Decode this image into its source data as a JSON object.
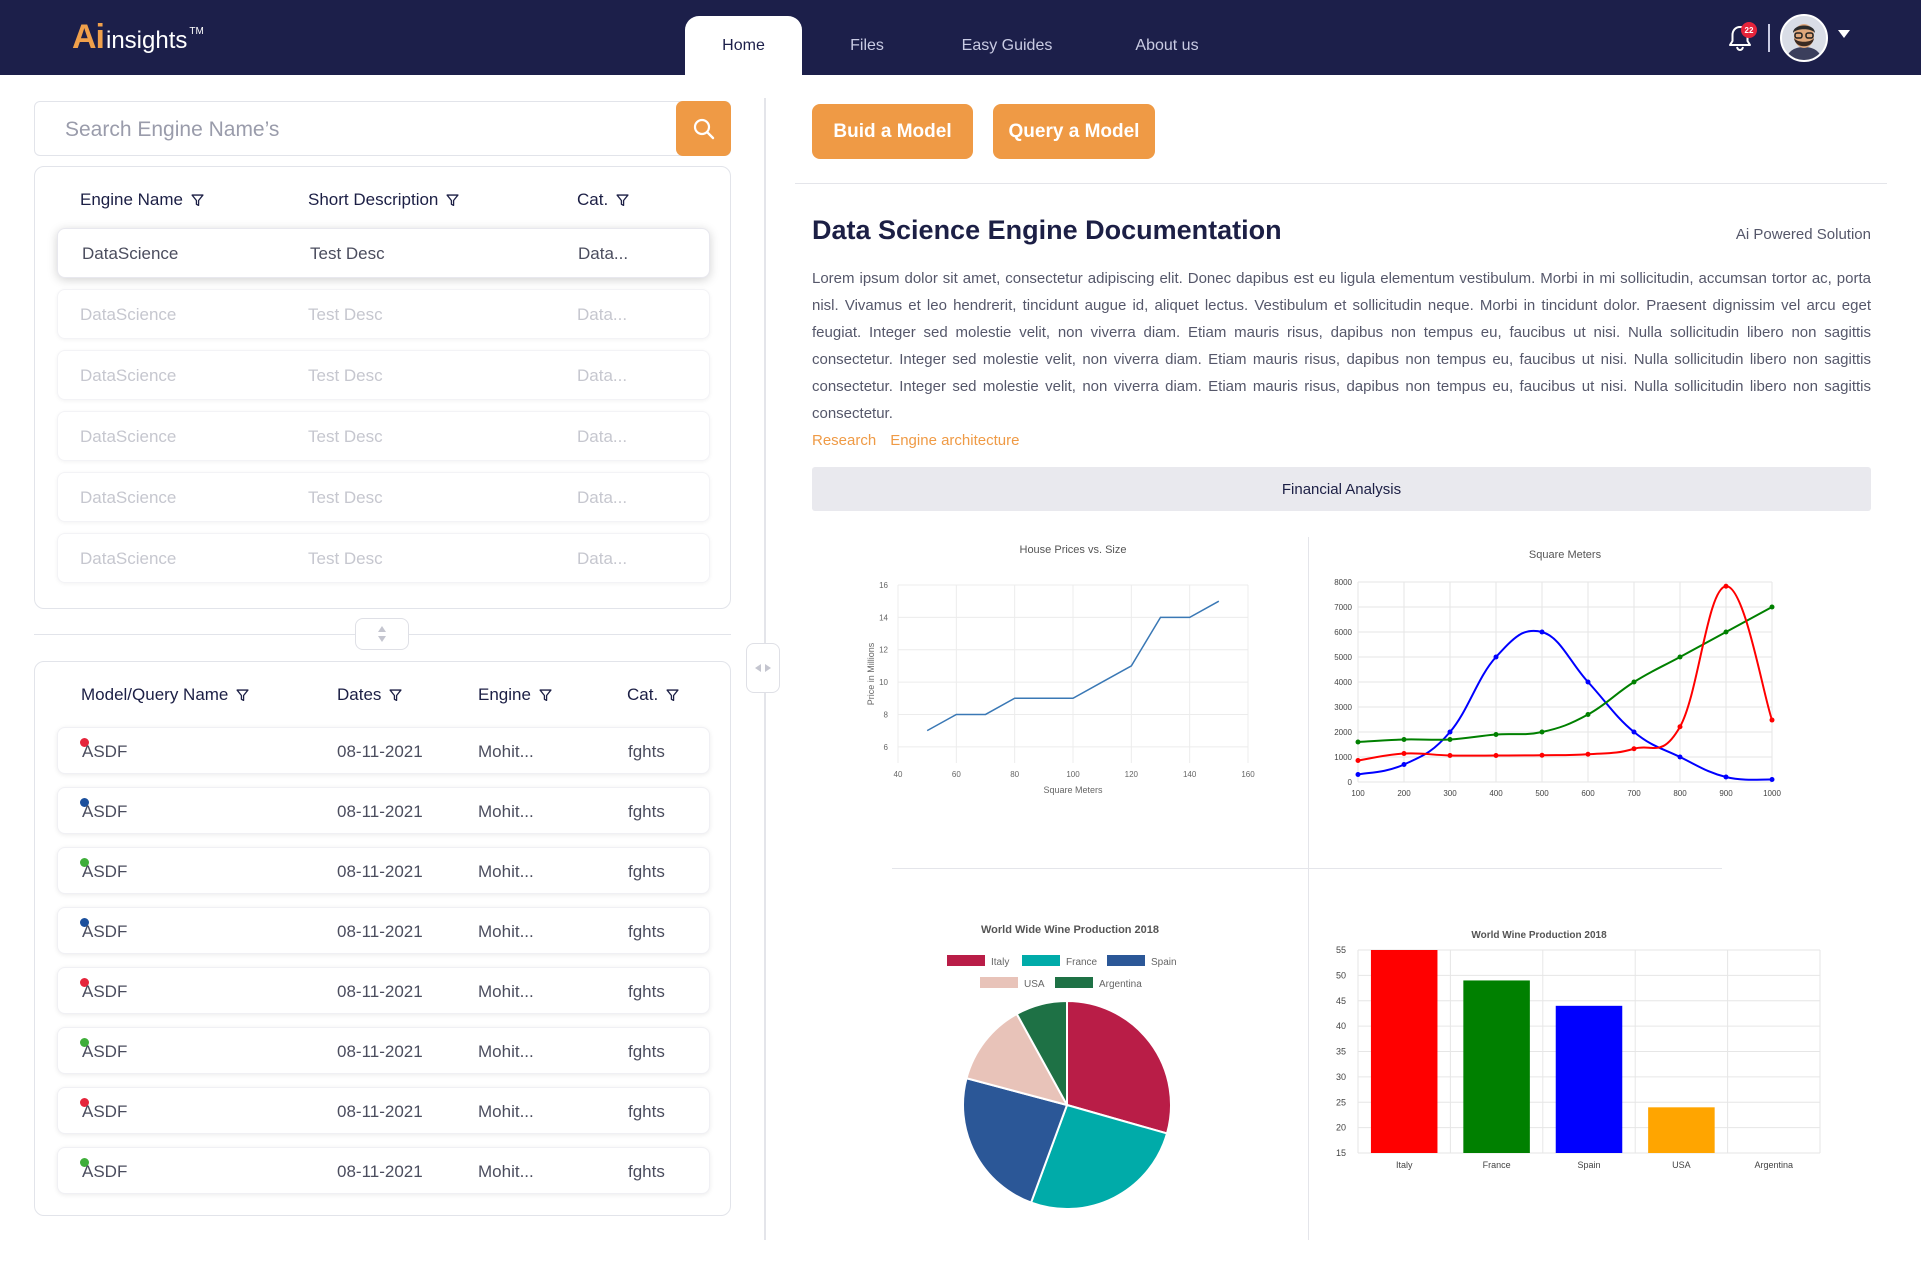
{
  "header": {
    "logo_ai": "Ai",
    "logo_rest": "insights",
    "logo_tm": "TM",
    "tabs": [
      {
        "label": "Home",
        "active": true
      },
      {
        "label": "Files",
        "active": false
      },
      {
        "label": "Easy Guides",
        "active": false
      },
      {
        "label": "About us",
        "active": false
      }
    ],
    "notification_count": "22",
    "icons": [
      "bell-icon",
      "avatar",
      "chevron-down-icon"
    ]
  },
  "search": {
    "placeholder": "Search Engine Name’s",
    "value": ""
  },
  "engines_table": {
    "headers": [
      "Engine Name",
      "Short Description",
      "Cat."
    ],
    "rows": [
      {
        "name": "DataScience",
        "desc": "Test Desc",
        "cat": "Data...",
        "selected": true
      },
      {
        "name": "DataScience",
        "desc": "Test Desc",
        "cat": "Data...",
        "selected": false
      },
      {
        "name": "DataScience",
        "desc": "Test Desc",
        "cat": "Data...",
        "selected": false
      },
      {
        "name": "DataScience",
        "desc": "Test Desc",
        "cat": "Data...",
        "selected": false
      },
      {
        "name": "DataScience",
        "desc": "Test Desc",
        "cat": "Data...",
        "selected": false
      },
      {
        "name": "DataScience",
        "desc": "Test Desc",
        "cat": "Data...",
        "selected": false
      }
    ]
  },
  "models_table": {
    "headers": [
      "Model/Query Name",
      "Dates",
      "Engine",
      "Cat."
    ],
    "rows": [
      {
        "name": "ASDF",
        "date": "08-11-2021",
        "engine": "Mohit...",
        "cat": "fghts",
        "status_color": "#e5243b"
      },
      {
        "name": "ASDF",
        "date": "08-11-2021",
        "engine": "Mohit...",
        "cat": "fghts",
        "status_color": "#1b4f9c"
      },
      {
        "name": "ASDF",
        "date": "08-11-2021",
        "engine": "Mohit...",
        "cat": "fghts",
        "status_color": "#3fae3a"
      },
      {
        "name": "ASDF",
        "date": "08-11-2021",
        "engine": "Mohit...",
        "cat": "fghts",
        "status_color": "#1b4f9c"
      },
      {
        "name": "ASDF",
        "date": "08-11-2021",
        "engine": "Mohit...",
        "cat": "fghts",
        "status_color": "#e5243b"
      },
      {
        "name": "ASDF",
        "date": "08-11-2021",
        "engine": "Mohit...",
        "cat": "fghts",
        "status_color": "#3fae3a"
      },
      {
        "name": "ASDF",
        "date": "08-11-2021",
        "engine": "Mohit...",
        "cat": "fghts",
        "status_color": "#e5243b"
      },
      {
        "name": "ASDF",
        "date": "08-11-2021",
        "engine": "Mohit...",
        "cat": "fghts",
        "status_color": "#3fae3a"
      }
    ]
  },
  "actions": {
    "build": "Buid a Model",
    "query": "Query a Model"
  },
  "doc": {
    "title": "Data Science Engine Documentation",
    "tag": "Ai Powered Solution",
    "body": "Lorem ipsum dolor sit amet, consectetur adipiscing elit. Donec dapibus est eu ligula elementum vestibulum. Morbi in mi sollicitudin, accumsan tortor ac, porta nisl. Vivamus et leo hendrerit, tincidunt augue id, aliquet lectus. Vestibulum et sollicitudin neque. Morbi in tincidunt dolor. Praesent dignissim vel arcu eget feugiat. Integer sed molestie velit, non viverra diam. Etiam mauris risus, dapibus non tempus eu, faucibus ut nisi. Nulla sollicitudin libero non sagittis consectetur. Integer sed molestie velit, non viverra diam. Etiam mauris risus, dapibus non tempus eu, faucibus ut nisi. Nulla sollicitudin libero non sagittis consectetur. Integer sed molestie velit, non viverra diam. Etiam mauris risus, dapibus non tempus eu, faucibus ut nisi. Nulla sollicitudin libero non sagittis consectetur.",
    "links": [
      "Research",
      "Engine architecture"
    ],
    "section_title": "Financial Analysis"
  },
  "chart_data": [
    {
      "type": "line",
      "title": "House Prices vs. Size",
      "xlabel": "Square Meters",
      "ylabel": "Price in Millions",
      "xlim": [
        40,
        160
      ],
      "ylim": [
        5,
        16
      ],
      "xticks": [
        40,
        60,
        80,
        100,
        120,
        140,
        160
      ],
      "yticks": [
        6,
        8,
        10,
        12,
        14,
        16
      ],
      "grid": true,
      "color": "#3a78b5",
      "x": [
        50,
        60,
        70,
        80,
        90,
        100,
        110,
        120,
        130,
        140,
        150
      ],
      "y": [
        7,
        8,
        8,
        9,
        9,
        9,
        10,
        11,
        14,
        14,
        15
      ]
    },
    {
      "type": "line",
      "title": "Square Meters",
      "xlim": [
        100,
        1000
      ],
      "ylim": [
        0,
        8000
      ],
      "xticks": [
        100,
        200,
        300,
        400,
        500,
        600,
        700,
        800,
        900,
        1000
      ],
      "yticks": [
        0,
        1000,
        2000,
        3000,
        4000,
        5000,
        6000,
        7000,
        8000
      ],
      "grid": true,
      "x": [
        100,
        200,
        300,
        400,
        500,
        600,
        700,
        800,
        900,
        1000
      ],
      "series": [
        {
          "color": "#0000ff",
          "values": [
            300,
            700,
            2000,
            5000,
            6000,
            4000,
            2000,
            1000,
            200,
            100
          ]
        },
        {
          "color": "#008000",
          "values": [
            1600,
            1700,
            1700,
            1900,
            2000,
            2700,
            4000,
            5000,
            6000,
            7000
          ]
        },
        {
          "color": "#ff0000",
          "values": [
            860,
            1140,
            1060,
            1060,
            1070,
            1110,
            1330,
            2210,
            7830,
            2478
          ]
        }
      ]
    },
    {
      "type": "pie",
      "title": "World Wide Wine Production 2018",
      "legend": "top",
      "categories": [
        "Italy",
        "France",
        "Spain",
        "USA",
        "Argentina"
      ],
      "values": [
        55,
        49,
        44,
        24,
        15
      ],
      "colors": [
        "#b91d47",
        "#00aba9",
        "#2b5797",
        "#e8c3b9",
        "#1e7145"
      ]
    },
    {
      "type": "bar",
      "title": "World Wine Production 2018",
      "categories": [
        "Italy",
        "France",
        "Spain",
        "USA",
        "Argentina"
      ],
      "values": [
        55,
        49,
        44,
        24,
        15
      ],
      "ylim": [
        15,
        55
      ],
      "yticks": [
        15,
        20,
        25,
        30,
        35,
        40,
        45,
        50,
        55
      ],
      "grid": true,
      "colors": [
        "#ff0000",
        "#008000",
        "#0000ff",
        "#ffa500",
        "#8b4513"
      ]
    }
  ]
}
